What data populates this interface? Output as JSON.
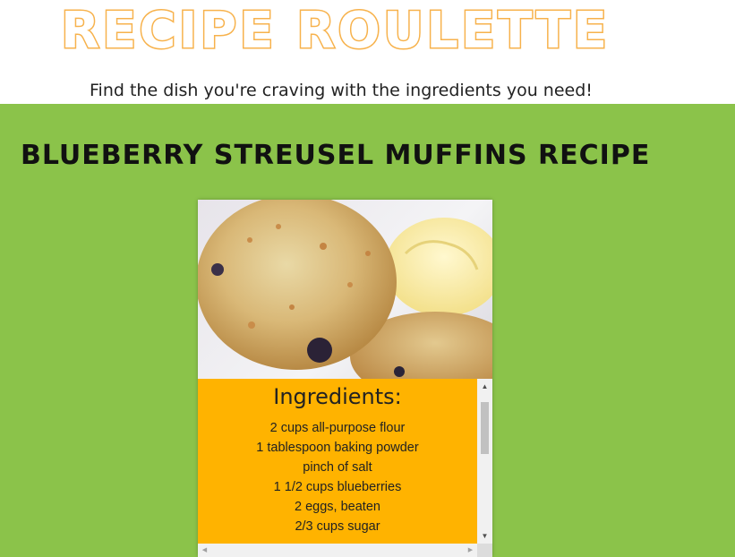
{
  "header": {
    "title": "RECIPE ROULETTE",
    "tagline": "Find the dish you're craving with the ingredients you need!"
  },
  "recipe": {
    "title": "BLUEBERRY STREUSEL MUFFINS RECIPE",
    "ingredients_heading": "Ingredients:",
    "ingredients": [
      "2 cups all-purpose flour",
      "1 tablespoon baking powder",
      "pinch of salt",
      "1 1/2 cups blueberries",
      "2 eggs, beaten",
      "2/3 cups sugar"
    ]
  },
  "scrollbar": {
    "up": "▲",
    "down": "▼",
    "left": "◀",
    "right": "▶"
  },
  "colors": {
    "title_orange": "#f7b24c",
    "main_green": "#8bc34a",
    "ingredients_orange": "#ffb300"
  },
  "icons": {
    "photo": "blueberry-muffin-photo"
  }
}
